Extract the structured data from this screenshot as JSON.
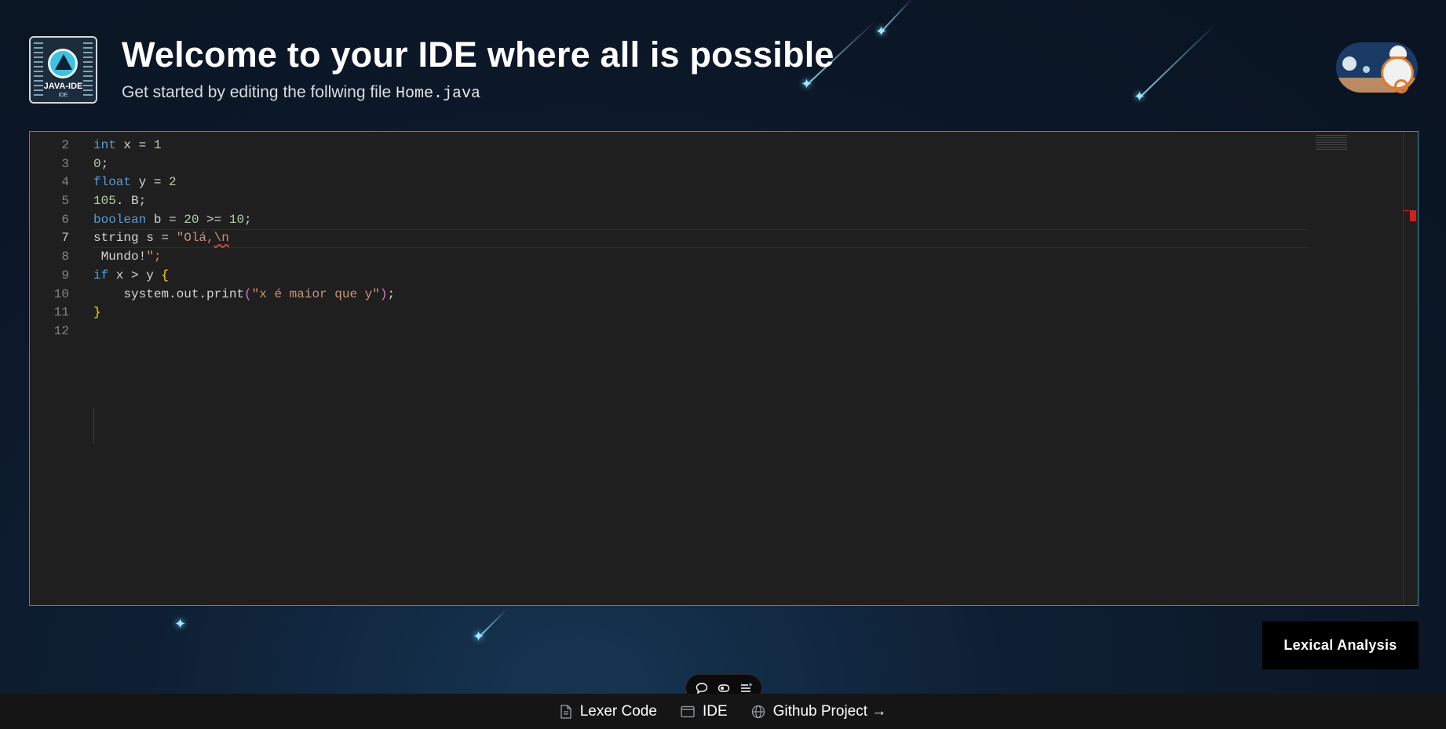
{
  "header": {
    "title": "Welcome to your IDE where all is possible",
    "subtitle_prefix": "Get started by editing the follwing file ",
    "file_name": "Home.java"
  },
  "logo": {
    "label": "JAVA-IDE",
    "sub_label": "IDE"
  },
  "editor": {
    "language": "java",
    "lines": [
      {
        "n": "2",
        "text": "int x = 1"
      },
      {
        "n": "3",
        "text": "0;"
      },
      {
        "n": "4",
        "text": "float y = 2"
      },
      {
        "n": "5",
        "text": "105. B;"
      },
      {
        "n": "6",
        "text": "boolean b = 20 >= 10;"
      },
      {
        "n": "7",
        "text": "string s = \"Olá,\\n"
      },
      {
        "n": "8",
        "text": " Mundo!\";"
      },
      {
        "n": "9",
        "text": "if (x > y) {"
      },
      {
        "n": "10",
        "text": "    system.out.print(\"x é maior que y\");"
      },
      {
        "n": "11",
        "text": "}"
      },
      {
        "n": "12",
        "text": ""
      }
    ],
    "current_line": "7"
  },
  "actions": {
    "lexical_button": "Lexical Analysis"
  },
  "floating_toolbar": {
    "icons": [
      "comment-icon",
      "toggle-icon",
      "menu-list-icon"
    ]
  },
  "footer": {
    "links": [
      {
        "label": "Lexer Code",
        "icon": "file-icon"
      },
      {
        "label": "IDE",
        "icon": "window-icon"
      },
      {
        "label": "Github Project →",
        "icon": "globe-icon"
      }
    ]
  },
  "colors": {
    "background": "#0b1626",
    "editor_bg": "#1f1f1f",
    "editor_border": "#3a8fa8",
    "keyword": "#569cd6",
    "number": "#b5cea8",
    "string": "#ce9178",
    "bracket": "#ffd700",
    "paren": "#da70d6",
    "button_bg": "#000000",
    "footer_bg": "#151515"
  }
}
